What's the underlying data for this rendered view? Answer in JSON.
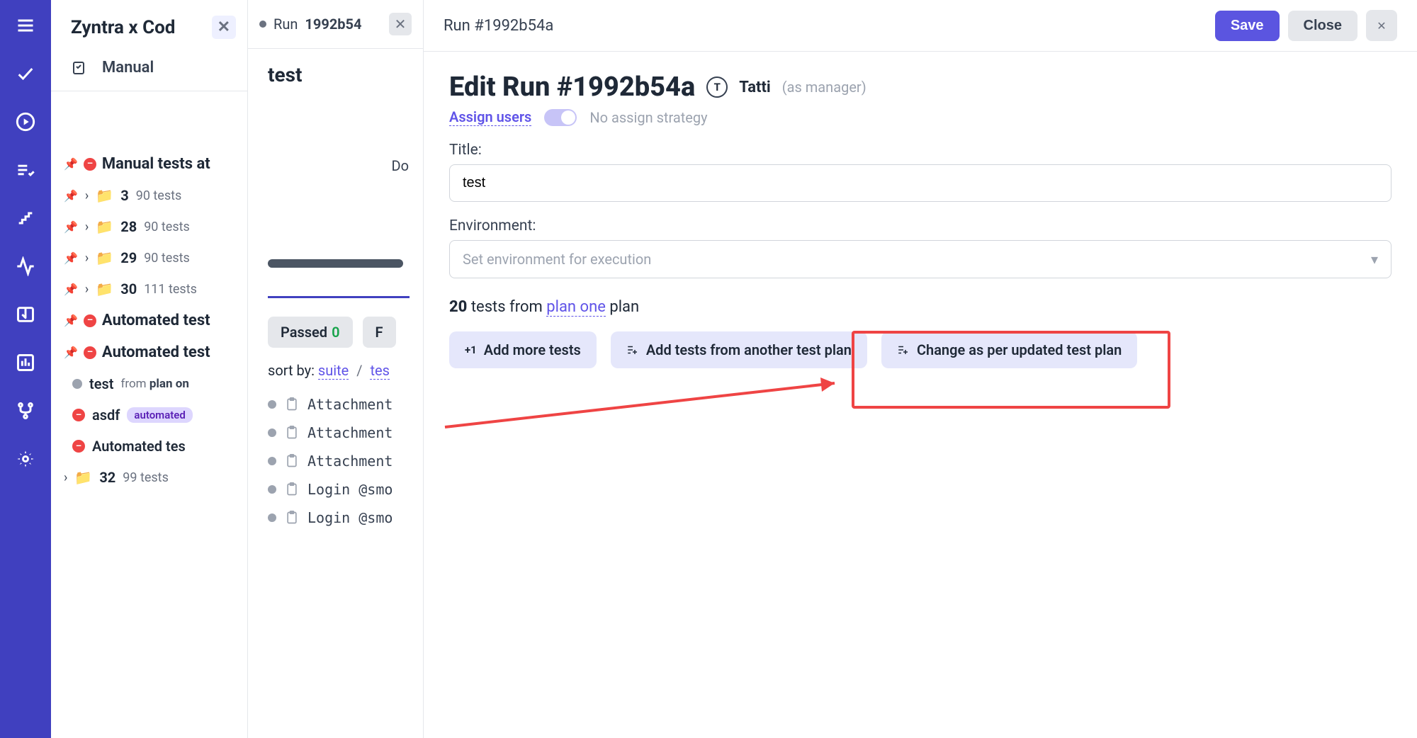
{
  "project_name": "Zyntra x Cod",
  "manual_label": "Manual",
  "tree": {
    "manual_group": "Manual tests at",
    "rows": [
      {
        "num": "3",
        "count": "90 tests"
      },
      {
        "num": "28",
        "count": "90 tests"
      },
      {
        "num": "29",
        "count": "90 tests"
      },
      {
        "num": "30",
        "count": "111 tests"
      }
    ],
    "auto_group_1": "Automated test",
    "auto_group_2": "Automated test",
    "runs": [
      {
        "dot": "gray",
        "name": "test",
        "from_label": "from",
        "from_plan": "plan on"
      },
      {
        "dot": "red",
        "name": "asdf",
        "badge": "automated"
      },
      {
        "dot": "red",
        "name": "Automated tes"
      }
    ],
    "row32_num": "32",
    "row32_count": "99 tests"
  },
  "midcol": {
    "tab_prefix": "Run",
    "tab_id": "1992b54",
    "run_title": "test",
    "do": "Do",
    "filter_passed_label": "Passed",
    "filter_passed_count": "0",
    "filter_failed_label": "F",
    "sort_label": "sort by:",
    "sort_suite": "suite",
    "sort_test": "tes",
    "tests": [
      "Attachment",
      "Attachment",
      "Attachment",
      "Login @smo",
      "Login @smo"
    ]
  },
  "main": {
    "breadcrumb": "Run #1992b54a",
    "save": "Save",
    "close": "Close",
    "edit_title": "Edit Run #1992b54a",
    "avatar_initial": "T",
    "username": "Tatti",
    "role": "(as manager)",
    "assign": "Assign users",
    "strategy": "No assign strategy",
    "title_label": "Title:",
    "title_value": "test",
    "env_label": "Environment:",
    "env_placeholder": "Set environment for execution",
    "tests_count": "20",
    "tests_from_mid": " tests from ",
    "tests_plan": "plan one",
    "tests_from_end": " plan",
    "chip_add_more": "Add more tests",
    "chip_add_another": "Add tests from another test plan",
    "chip_change": "Change as per updated test plan"
  }
}
